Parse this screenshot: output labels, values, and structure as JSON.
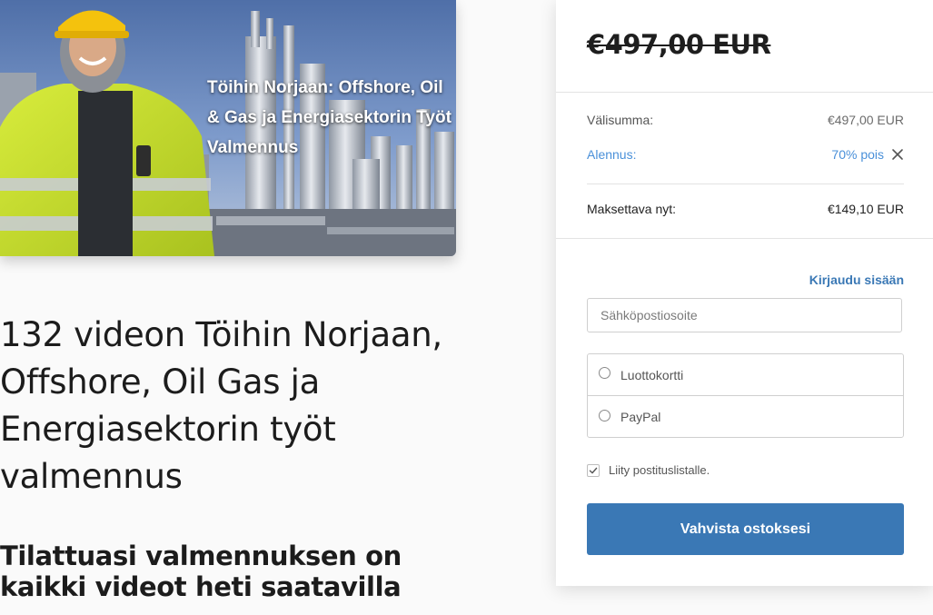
{
  "hero": {
    "overlay_title": "Töihin Norjaan: Offshore, Oil & Gas ja Energiasektorin Työt Valmennus",
    "image_icon": "offshore-worker-refinery-photo"
  },
  "course": {
    "title": "132 videon Töihin Norjaan, Offshore, Oil Gas ja Energiasektorin työt valmennus",
    "subtitle": "Tilattuasi valmennuksen on kaikki videot heti saatavilla"
  },
  "checkout": {
    "original_price": "€497,00 EUR",
    "subtotal_label": "Välisumma:",
    "subtotal_value": "€497,00 EUR",
    "discount_label": "Alennus:",
    "discount_value": "70% pois",
    "remove_discount_icon": "close-icon",
    "total_label": "Maksettava nyt:",
    "total_value": "€149,10 EUR",
    "login_link": "Kirjaudu sisään",
    "email_placeholder": "Sähköpostiosoite",
    "payment_options": [
      {
        "label": "Luottokortti",
        "selected": false
      },
      {
        "label": "PayPal",
        "selected": false
      }
    ],
    "newsletter_label": "Liity postituslistalle.",
    "newsletter_checked": true,
    "confirm_button": "Vahvista ostoksesi"
  },
  "colors": {
    "accent": "#3a78b5",
    "discount": "#4a90d9",
    "text": "#222222",
    "muted": "#555555",
    "background": "#fafafa"
  }
}
